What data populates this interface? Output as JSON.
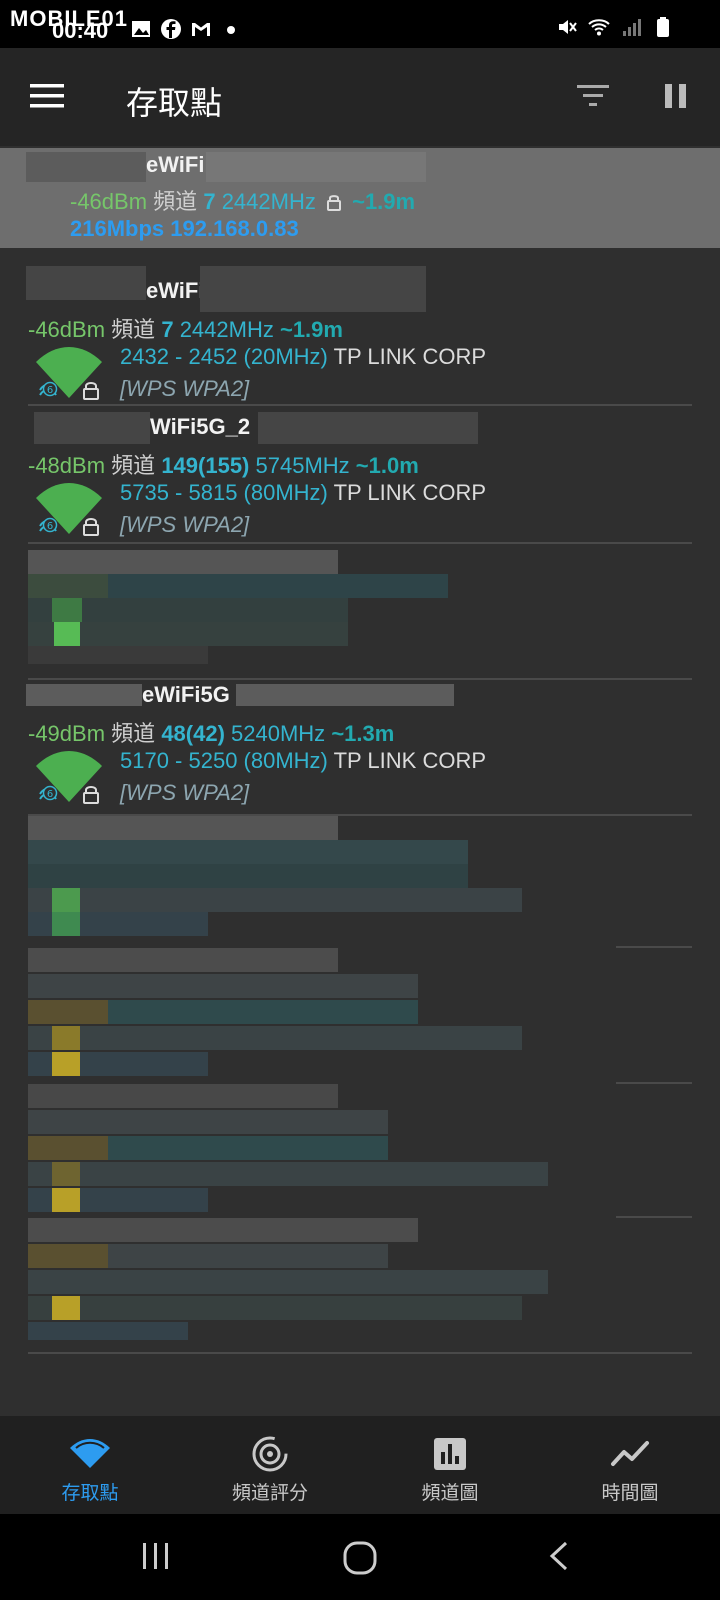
{
  "status_bar": {
    "watermark": "MOBILE01",
    "time": "00:40",
    "left_icons": [
      "gallery-icon",
      "facebook-icon",
      "gmail-icon",
      "dot-icon"
    ],
    "right_icons": [
      "mute-icon",
      "wifi-icon",
      "signal-icon",
      "battery-icon"
    ]
  },
  "app_bar": {
    "title": "存取點",
    "actions": [
      "filter-icon",
      "pause-icon"
    ]
  },
  "connected": {
    "ssid": "eWiFi",
    "signal": "-46dBm",
    "channel_label": "頻道",
    "channel": "7",
    "freq": "2442MHz",
    "distance": "~1.9m",
    "link_info": "216Mbps 192.168.0.83"
  },
  "networks": [
    {
      "ssid": "eWiFi",
      "signal": "-46dBm",
      "channel_label": "頻道",
      "channel": "7",
      "freq": "2442MHz",
      "distance": "~1.9m",
      "range": "2432 - 2452 (20MHz)",
      "vendor": "TP LINK CORP",
      "caps": "[WPS WPA2]"
    },
    {
      "ssid": "WiFi5G_2",
      "signal": "-48dBm",
      "channel_label": "頻道",
      "channel": "149(155)",
      "freq": "5745MHz",
      "distance": "~1.0m",
      "range": "5735 - 5815 (80MHz)",
      "vendor": "TP LINK CORP",
      "caps": "[WPS WPA2]"
    },
    {
      "ssid": "eWiFi5G",
      "signal": "-49dBm",
      "channel_label": "頻道",
      "channel": "48(42)",
      "freq": "5240MHz",
      "distance": "~1.3m",
      "range": "5170 - 5250 (80MHz)",
      "vendor": "TP LINK CORP",
      "caps": "[WPS WPA2]"
    }
  ],
  "bottom_nav": [
    {
      "label": "存取點",
      "icon": "wifi-icon",
      "active": true
    },
    {
      "label": "頻道評分",
      "icon": "radar-icon",
      "active": false
    },
    {
      "label": "頻道圖",
      "icon": "bar-chart-icon",
      "active": false
    },
    {
      "label": "時間圖",
      "icon": "line-chart-icon",
      "active": false
    }
  ],
  "system_nav": [
    "recents-icon",
    "home-icon",
    "back-icon"
  ],
  "colors": {
    "accent_blue": "#2d9cf0",
    "signal_green": "#76c66a",
    "channel_cyan": "#34b4cf",
    "distance_teal": "#22aab0",
    "wifi_green": "#4caf50"
  }
}
